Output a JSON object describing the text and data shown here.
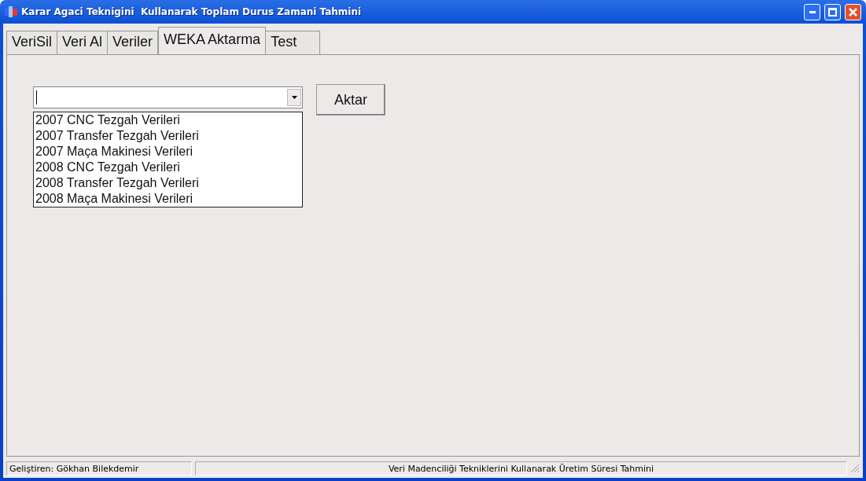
{
  "window": {
    "title": "Karar Agaci Teknigini  Kullanarak Toplam Durus Zamani Tahmini"
  },
  "tabs": [
    {
      "label": "VeriSil",
      "selected": false
    },
    {
      "label": "Veri Al",
      "selected": false
    },
    {
      "label": "Veriler",
      "selected": false
    },
    {
      "label": "WEKA Aktarma",
      "selected": true
    },
    {
      "label": "Test",
      "selected": false
    }
  ],
  "combo": {
    "expanded": true,
    "options": [
      "2007 CNC Tezgah Verileri",
      "2007 Transfer Tezgah Verileri",
      "2007 Maça Makinesi Verileri",
      "2008 CNC Tezgah Verileri",
      "2008 Transfer Tezgah Verileri",
      "2008 Maça Makinesi Verileri"
    ]
  },
  "button": "Aktar",
  "status_bar": [
    "Geliştiren: Gökhan Bilekdemir",
    "Veri Madenciliği Tekniklerini Kullanarak Üretim Süresi Tahmini"
  ]
}
